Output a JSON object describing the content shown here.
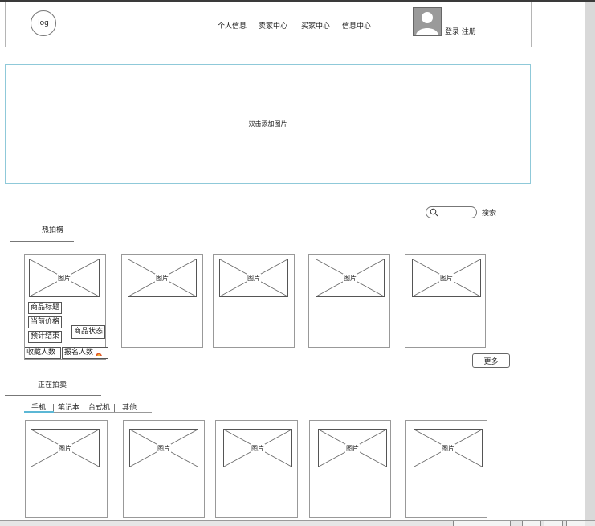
{
  "header": {
    "logo": "log",
    "nav": [
      "个人信息",
      "卖家中心",
      "买家中心",
      "信息中心"
    ],
    "login": "登录",
    "register": "注册",
    "avatar_icon": "user-avatar-icon"
  },
  "banner": {
    "text": "双击添加图片"
  },
  "search": {
    "placeholder": "",
    "button": "搜索",
    "icon": "search-icon"
  },
  "hot": {
    "title": "热拍榜",
    "placeholder": "图片",
    "first_card": {
      "title_label": "商品标题",
      "price_label": "当前价格",
      "end_label": "预计结束",
      "status_label": "商品状态",
      "fav_label": "收藏人数",
      "signup_label": "报名人数"
    },
    "more": "更多"
  },
  "auction": {
    "title": "正在拍卖",
    "tabs": [
      "手机",
      "笔记本",
      "台式机",
      "其他"
    ],
    "active_tab": 0,
    "placeholder": "图片"
  },
  "colors": {
    "accent": "#5bb7d5",
    "border": "#999999"
  }
}
